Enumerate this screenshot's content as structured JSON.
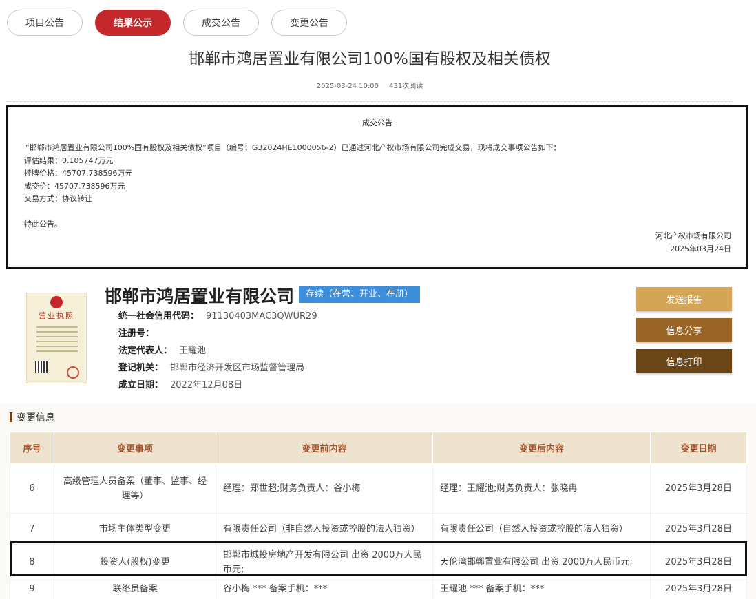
{
  "tabs": [
    {
      "label": "项目公告",
      "active": false
    },
    {
      "label": "结果公示",
      "active": true
    },
    {
      "label": "成交公告",
      "active": false
    },
    {
      "label": "变更公告",
      "active": false
    }
  ],
  "article": {
    "title": "邯郸市鸿居置业有限公司100%国有股权及相关债权",
    "datetime": "2025-03-24 10:00",
    "views": "431次阅读"
  },
  "announcement": {
    "heading": "成交公告",
    "intro": "“邯郸市鸿居置业有限公司100%国有股权及相关债权”项目（编号：G32024HE1000056-2）已通过河北产权市场有限公司完成交易，现将成交事项公告如下：",
    "lines": [
      "评估结果：0.105747万元",
      "挂牌价格：45707.738596万元",
      "成交价：45707.738596万元",
      "交易方式：协议转让"
    ],
    "closing": "特此公告。",
    "signer": "河北产权市场有限公司",
    "sign_date": "2025年03月24日"
  },
  "company": {
    "name": "邯郸市鸿居置业有限公司",
    "status": "存续（在营、开业、在册）",
    "license_label": "营业执照",
    "fields": [
      {
        "key": "统一社会信用代码：",
        "value": "91130403MAC3QWUR29"
      },
      {
        "key": "注册号：",
        "value": ""
      },
      {
        "key": "法定代表人：",
        "value": "王耀池"
      },
      {
        "key": "登记机关：",
        "value": "邯郸市经济开发区市场监督管理局"
      },
      {
        "key": "成立日期：",
        "value": "2022年12月08日"
      }
    ]
  },
  "actions": {
    "send_report": "发送报告",
    "share": "信息分享",
    "print": "信息打印"
  },
  "changes": {
    "section_title": "变更信息",
    "headers": [
      "序号",
      "变更事项",
      "变更前内容",
      "变更后内容",
      "变更日期"
    ],
    "rows": [
      {
        "no": "6",
        "item": "高级管理人员备案（董事、监事、经理等）",
        "before": "经理：郑世超;财务负责人：谷小梅",
        "after": "经理：王耀池;财务负责人：张晓冉",
        "date": "2025年3月28日"
      },
      {
        "no": "7",
        "item": "市场主体类型变更",
        "before": "有限责任公司（非自然人投资或控股的法人独资）",
        "after": "有限责任公司（自然人投资或控股的法人独资）",
        "date": "2025年3月28日"
      },
      {
        "no": "8",
        "item": "投资人(股权)变更",
        "before": "邯郸市城投房地产开发有限公司 出资 2000万人民币元;",
        "after": "天伦湾邯郸置业有限公司 出资 2000万人民币元;",
        "date": "2025年3月28日"
      },
      {
        "no": "9",
        "item": "联络员备案",
        "before": "谷小梅 *** 备案手机：***",
        "after": "王耀池 *** 备案手机：***",
        "date": "2025年3月28日"
      }
    ]
  },
  "colors": {
    "tab_active": "#c5282b",
    "status_badge": "#3d8fdc",
    "btn_send": "#d4a556",
    "btn_share": "#9a6628",
    "btn_print": "#6a4516",
    "table_header_bg": "#ede3cf",
    "table_header_text": "#a0522d"
  }
}
